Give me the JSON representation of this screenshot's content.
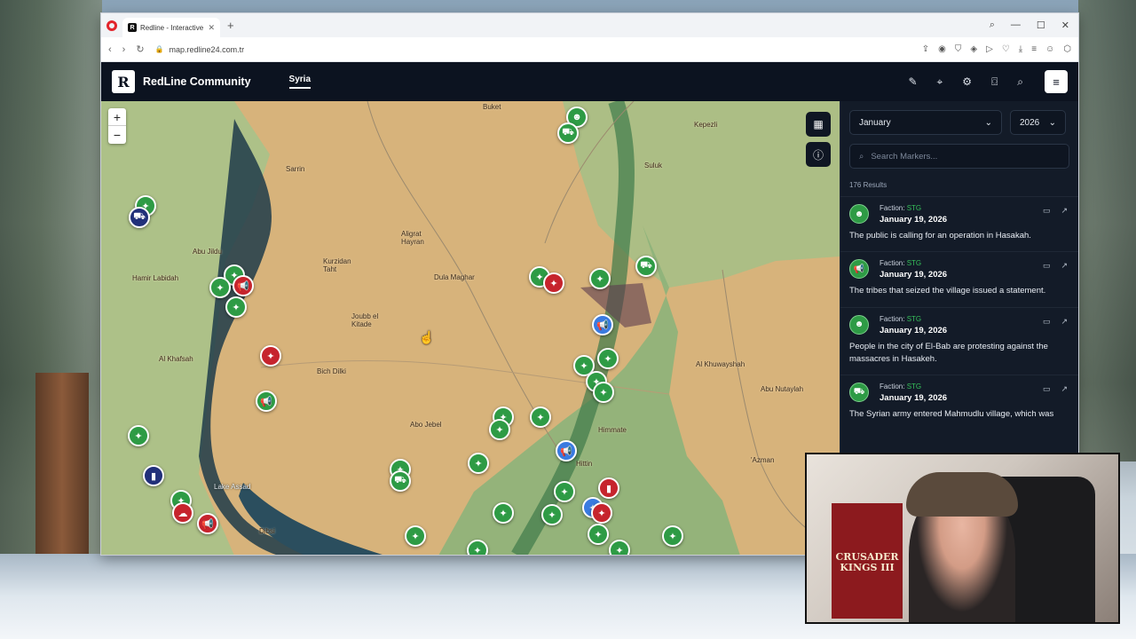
{
  "browser": {
    "tab_title": "Redline - Interactive Strat",
    "tab_favicon": "R",
    "url": "map.redline24.com.tr"
  },
  "app": {
    "logo_letter": "R",
    "brand": "RedLine Community",
    "nav_active": "Syria",
    "icons": [
      "tag-icon",
      "pin-icon",
      "gear-icon",
      "camera-icon",
      "search-icon",
      "menu-icon"
    ]
  },
  "map": {
    "zoom_in": "+",
    "zoom_out": "−",
    "labels": [
      {
        "id": "buket",
        "text": "Buket"
      },
      {
        "id": "kepezli",
        "text": "Kepezli"
      },
      {
        "id": "suluk",
        "text": "Suluk"
      },
      {
        "id": "sarrin",
        "text": "Sarrin"
      },
      {
        "id": "aligrat",
        "text": "Aligrat\nHayran"
      },
      {
        "id": "kurzidan",
        "text": "Kurzidan\nTaht"
      },
      {
        "id": "dula",
        "text": "Dula Maghar"
      },
      {
        "id": "jbula",
        "text": "Joubb el\nKitade"
      },
      {
        "id": "hamir",
        "text": "Hamir Labidah"
      },
      {
        "id": "abu_jdu",
        "text": "Abu Jildu"
      },
      {
        "id": "bich",
        "text": "Bich Dilki"
      },
      {
        "id": "khafsah",
        "text": "Al Khafsah"
      },
      {
        "id": "abu_ubb",
        "text": "Abo Jebel"
      },
      {
        "id": "lake",
        "text": "Lake Assad"
      },
      {
        "id": "dibsi",
        "text": "Dibsi"
      },
      {
        "id": "khuwayshah",
        "text": "Al Khuwayshah"
      },
      {
        "id": "abu_nutayla",
        "text": "Abu Nutaylah"
      },
      {
        "id": "azman",
        "text": "'Azman"
      },
      {
        "id": "hittin",
        "text": "Hittin"
      },
      {
        "id": "hammam",
        "text": "Himmate"
      }
    ]
  },
  "sidebar": {
    "month": "January",
    "year": "2026",
    "search_placeholder": "Search Markers...",
    "results": "176 Results",
    "faction_prefix": "Faction:",
    "items": [
      {
        "faction": "STG",
        "date": "January 19, 2026",
        "text": "The public is calling for an operation in Hasakah.",
        "icon": "people-icon"
      },
      {
        "faction": "STG",
        "date": "January 19, 2026",
        "text": "The tribes that seized the village issued a statement.",
        "icon": "megaphone-icon"
      },
      {
        "faction": "STG",
        "date": "January 19, 2026",
        "text": "People in the city of El-Bab are protesting against the massacres in Hasakeh.",
        "icon": "people-icon"
      },
      {
        "faction": "STG",
        "date": "January 19, 2026",
        "text": "The Syrian army entered Mahmudlu village, which was",
        "icon": "truck-icon"
      }
    ]
  },
  "webcam": {
    "poster_text": "CRUSADER KINGS III"
  }
}
